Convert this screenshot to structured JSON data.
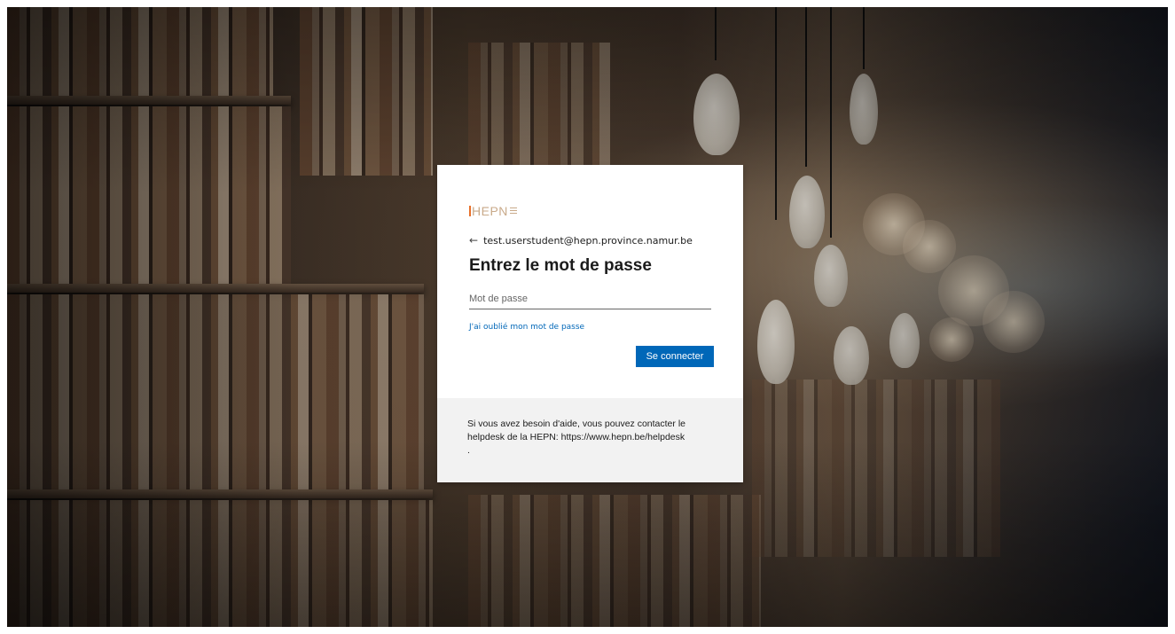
{
  "background": {
    "description_icon": "library-bookshelves-background"
  },
  "login": {
    "logo_text": "HEPN",
    "identity": {
      "back_icon": "←",
      "email": "test.userstudent@hepn.province.namur.be"
    },
    "title": "Entrez le mot de passe",
    "password_field": {
      "placeholder": "Mot de passe",
      "value": ""
    },
    "forgot_link": "J'ai oublié mon mot de passe",
    "signin_button": "Se connecter",
    "help": {
      "text": "Si vous avez besoin d'aide, vous pouvez contacter le helpdesk de la HEPN: https://www.hepn.be/helpdesk",
      "trailing": "."
    }
  },
  "colors": {
    "accent": "#0067b8",
    "logo": "#c9aa8a",
    "logo_mark": "#e8702a",
    "footer_bg": "#f2f2f2"
  }
}
